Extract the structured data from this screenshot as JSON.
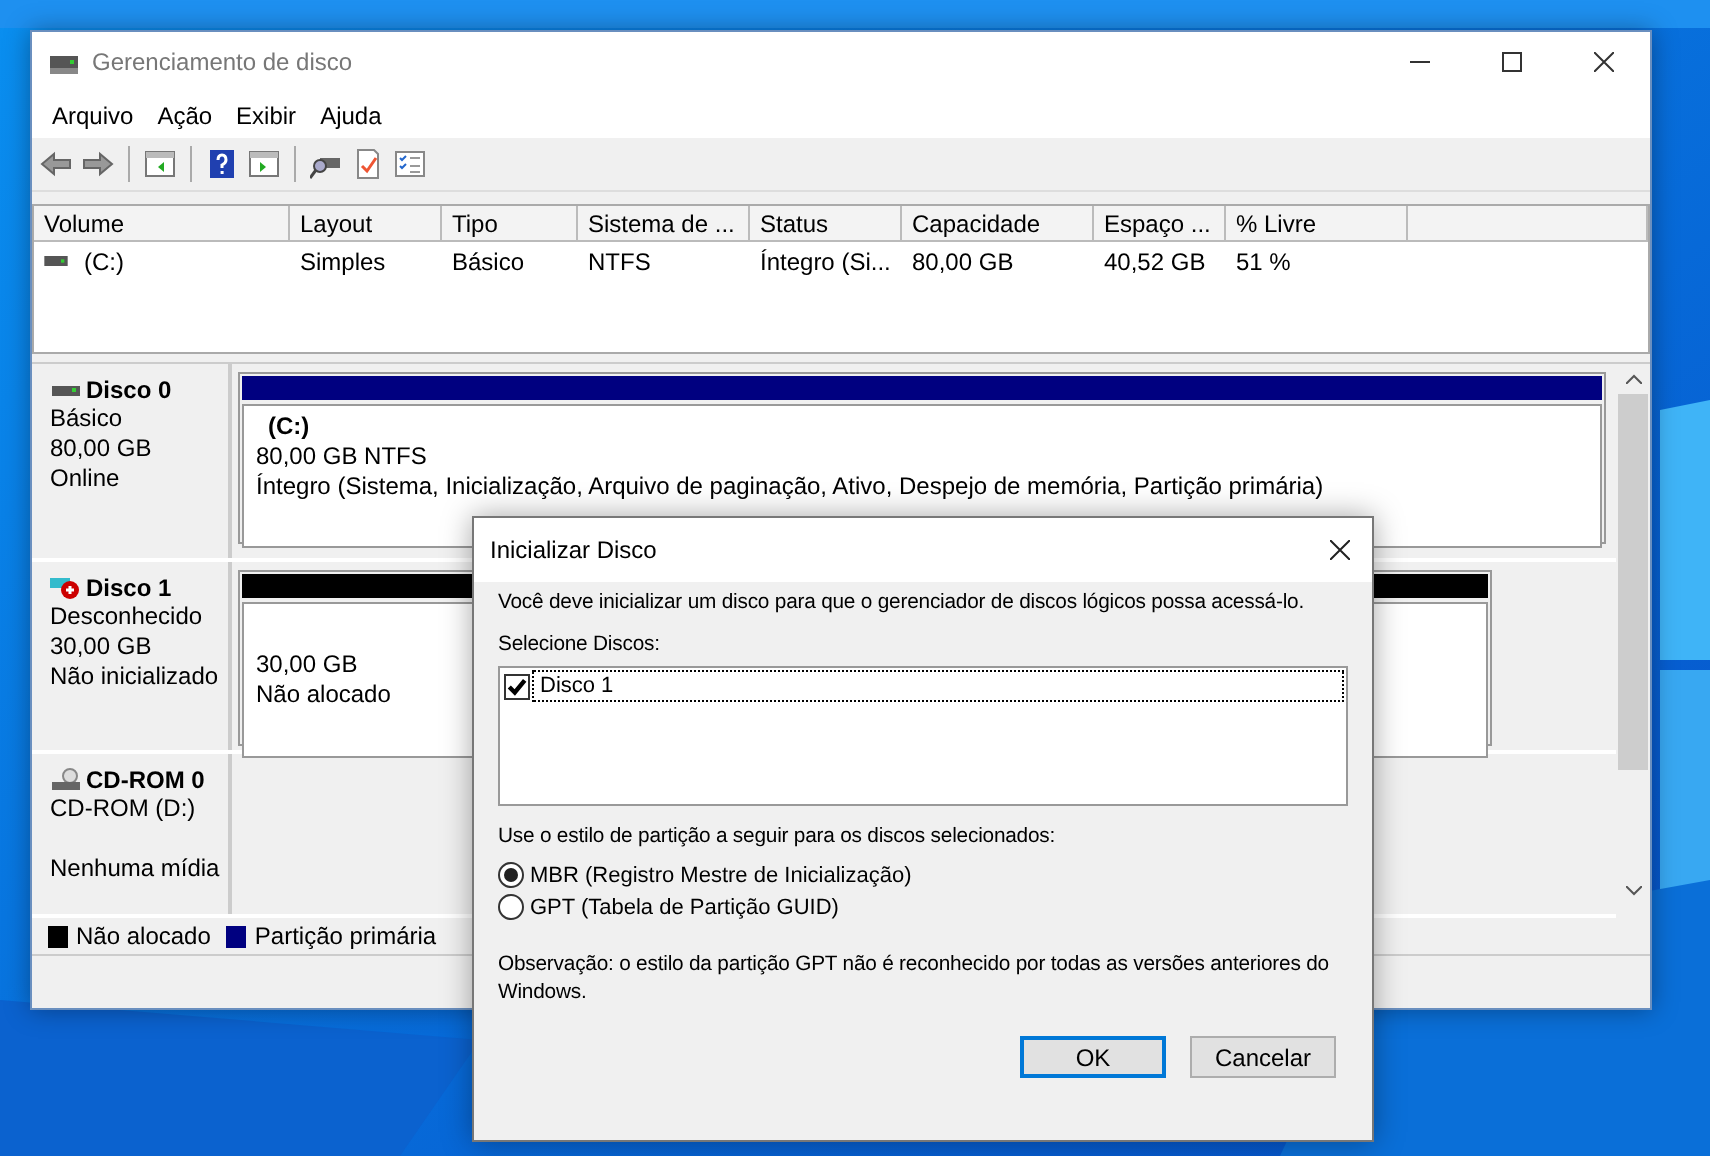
{
  "window": {
    "title": "Gerenciamento de disco"
  },
  "menu": [
    "Arquivo",
    "Ação",
    "Exibir",
    "Ajuda"
  ],
  "volume_table": {
    "columns": [
      "Volume",
      "Layout",
      "Tipo",
      "Sistema de ...",
      "Status",
      "Capacidade",
      "Espaço ...",
      "% Livre"
    ],
    "rows": [
      {
        "cells": [
          "(C:)",
          "Simples",
          "Básico",
          "NTFS",
          "Íntegro (Si...",
          "80,00 GB",
          "40,52 GB",
          "51 %"
        ]
      }
    ]
  },
  "disks": [
    {
      "name": "Disco 0",
      "kind": "basic",
      "lines": [
        "Básico",
        "80,00 GB",
        "Online"
      ],
      "partition": {
        "kind": "primary",
        "title": "(C:)",
        "lines": [
          "80,00 GB NTFS",
          "Íntegro (Sistema, Inicialização, Arquivo de paginação, Ativo, Despejo de memória, Partição primária)"
        ]
      }
    },
    {
      "name": "Disco 1",
      "kind": "unknown",
      "lines": [
        "Desconhecido",
        "30,00 GB",
        "Não inicializado"
      ],
      "partition": {
        "kind": "unallocated",
        "lines": [
          "30,00 GB",
          "Não alocado"
        ]
      }
    },
    {
      "name": "CD-ROM 0",
      "kind": "cdrom",
      "lines": [
        "CD-ROM (D:)",
        "Nenhuma mídia"
      ]
    }
  ],
  "legend": [
    {
      "label": "Não alocado",
      "color": "#000000"
    },
    {
      "label": "Partição primária",
      "color": "#000080"
    }
  ],
  "dialog": {
    "title": "Inicializar Disco",
    "message": "Você deve inicializar um disco para que o gerenciador de discos lógicos possa acessá-lo.",
    "list_label": "Selecione Discos:",
    "disks": [
      {
        "label": "Disco 1",
        "checked": true,
        "selected": true
      }
    ],
    "style_label": "Use o estilo de partição a seguir para os discos selecionados:",
    "styles": [
      {
        "label": "MBR (Registro Mestre de Inicialização)",
        "selected": true
      },
      {
        "label": "GPT (Tabela de Partição GUID)",
        "selected": false
      }
    ],
    "note": "Observação: o estilo da partição GPT não é reconhecido por todas as versões anteriores do Windows.",
    "buttons": [
      {
        "label": "OK",
        "default": true
      },
      {
        "label": "Cancelar",
        "default": false
      }
    ]
  }
}
